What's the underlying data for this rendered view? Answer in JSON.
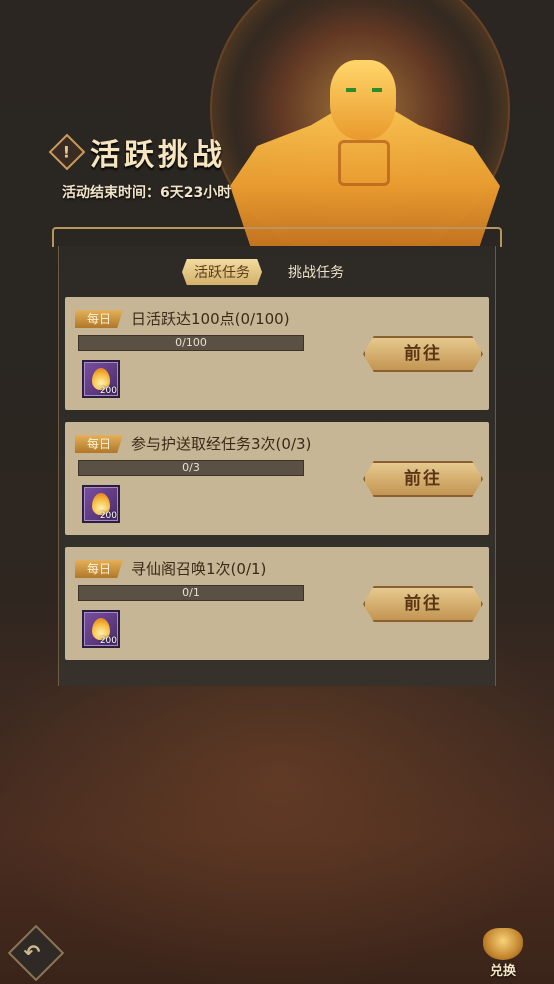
{
  "header": {
    "title": "活跃挑战",
    "info_icon": "exclamation-icon",
    "end_time": "活动结束时间：6天23小时"
  },
  "tabs": [
    {
      "label": "活跃任务",
      "active": true
    },
    {
      "label": "挑战任务",
      "active": false
    }
  ],
  "tasks": [
    {
      "badge": "每日",
      "title": "日活跃达100点(0/100)",
      "progress_text": "0/100",
      "progress": 0,
      "reward_icon": "flame-icon",
      "reward_qty": "200",
      "button": "前往"
    },
    {
      "badge": "每日",
      "title": "参与护送取经任务3次(0/3)",
      "progress_text": "0/3",
      "progress": 0,
      "reward_icon": "flame-icon",
      "reward_qty": "200",
      "button": "前往"
    },
    {
      "badge": "每日",
      "title": "寻仙阁召唤1次(0/1)",
      "progress_text": "0/1",
      "progress": 0,
      "reward_icon": "flame-icon",
      "reward_qty": "200",
      "button": "前往"
    }
  ],
  "footer": {
    "back_icon": "back-arrow-icon",
    "exchange_label": "兑换",
    "exchange_icon": "treasure-pot-icon"
  },
  "colors": {
    "accent_gold": "#d3b06a",
    "card_bg": "#c6b695",
    "reward_purple": "#7a4ea0"
  }
}
